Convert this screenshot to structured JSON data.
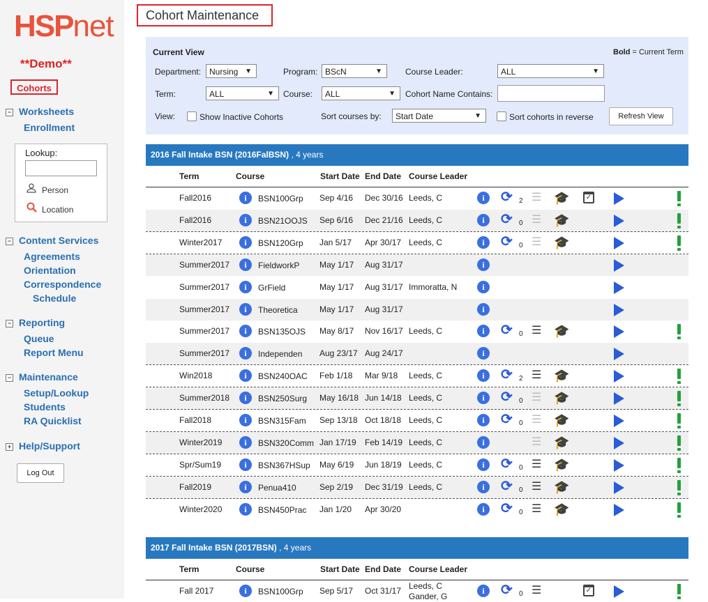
{
  "sidebar": {
    "logo_a": "HSP",
    "logo_b": "net",
    "demo": "**Demo**",
    "cohorts": "Cohorts",
    "worksheets": "Worksheets",
    "enrollment": "Enrollment",
    "lookup_label": "Lookup:",
    "person": "Person",
    "location": "Location",
    "content_services": "Content Services",
    "agreements": "Agreements",
    "orientation": "Orientation",
    "correspondence": "Correspondence",
    "schedule": "Schedule",
    "reporting": "Reporting",
    "queue": "Queue",
    "report_menu": "Report Menu",
    "maintenance": "Maintenance",
    "setup_lookup": "Setup/Lookup",
    "students": "Students",
    "ra_quicklist": "RA Quicklist",
    "help_support": "Help/Support",
    "logout": "Log Out",
    "toggle_minus": "−",
    "toggle_plus": "+"
  },
  "page": {
    "title": "Cohort Maintenance"
  },
  "current_view": {
    "heading": "Current View",
    "bold_note": "Bold = Current Term",
    "department_label": "Department:",
    "department_value": "Nursing",
    "program_label": "Program:",
    "program_value": "BScN",
    "course_leader_label": "Course Leader:",
    "course_leader_value": "ALL",
    "term_label": "Term:",
    "term_value": "ALL",
    "course_label": "Course:",
    "course_value": "ALL",
    "cohort_name_label": "Cohort Name Contains:",
    "view_label": "View:",
    "show_inactive": "Show Inactive Cohorts",
    "sort_label": "Sort courses by:",
    "sort_value": "Start Date",
    "sort_reverse": "Sort cohorts in reverse",
    "refresh": "Refresh View"
  },
  "columns": {
    "term": "Term",
    "course": "Course",
    "start": "Start Date",
    "end": "End Date",
    "leader": "Course Leader"
  },
  "cohort1": {
    "name": "2016 Fall Intake BSN (2016FalBSN)",
    "suffix": ", 4 years",
    "rows": [
      {
        "term": "Fall2016",
        "course": "BSN100Grp",
        "start": "Sep 4/16",
        "end": "Dec 30/16",
        "leader": "Leeds, C",
        "count": "2"
      },
      {
        "term": "Fall2016",
        "course": "BSN21OOJS",
        "start": "Sep 6/16",
        "end": "Dec 21/16",
        "leader": "Leeds, C",
        "count": "0"
      },
      {
        "term": "Winter2017",
        "course": "BSN120Grp",
        "start": "Jan 5/17",
        "end": "Apr 30/17",
        "leader": "Leeds, C",
        "count": "0"
      },
      {
        "term": "Summer2017",
        "course": "FieldworkP",
        "start": "May 1/17",
        "end": "Aug 31/17",
        "leader": "",
        "count": ""
      },
      {
        "term": "Summer2017",
        "course": "GrField",
        "start": "May 1/17",
        "end": "Aug 31/17",
        "leader": "Immoratta, N",
        "count": ""
      },
      {
        "term": "Summer2017",
        "course": "Theoretica",
        "start": "May 1/17",
        "end": "Aug 31/17",
        "leader": "",
        "count": ""
      },
      {
        "term": "Summer2017",
        "course": "BSN135OJS",
        "start": "May 8/17",
        "end": "Nov 16/17",
        "leader": "Leeds, C",
        "count": "0"
      },
      {
        "term": "Summer2017",
        "course": "Independen",
        "start": "Aug 23/17",
        "end": "Aug 24/17",
        "leader": "",
        "count": ""
      },
      {
        "term": "Win2018",
        "course": "BSN240OAC",
        "start": "Feb 1/18",
        "end": "Mar 9/18",
        "leader": "Leeds, C",
        "count": "2"
      },
      {
        "term": "Summer2018",
        "course": "BSN250Surg",
        "start": "May 16/18",
        "end": "Jun 14/18",
        "leader": "Leeds, C",
        "count": "0"
      },
      {
        "term": "Fall2018",
        "course": "BSN315Fam",
        "start": "Sep 13/18",
        "end": "Oct 18/18",
        "leader": "Leeds, C",
        "count": "0"
      },
      {
        "term": "Winter2019",
        "course": "BSN320Comm",
        "start": "Jan 17/19",
        "end": "Feb 14/19",
        "leader": "Leeds, C",
        "count": ""
      },
      {
        "term": "Spr/Sum19",
        "course": "BSN367HSup",
        "start": "May 6/19",
        "end": "Jun 18/19",
        "leader": "Leeds, C",
        "count": "0"
      },
      {
        "term": "Fall2019",
        "course": "Penua410",
        "start": "Sep 2/19",
        "end": "Dec 31/19",
        "leader": "Leeds, C",
        "count": "0"
      },
      {
        "term": "Winter2020",
        "course": "BSN450Prac",
        "start": "Jan 1/20",
        "end": "Apr 30/20",
        "leader": "",
        "count": "0"
      }
    ]
  },
  "cohort2": {
    "name": "2017 Fall Intake BSN (2017BSN)",
    "suffix": ", 4 years",
    "rows": [
      {
        "term": "Fall 2017",
        "course": "BSN100Grp",
        "start": "Sep 5/17",
        "end": "Oct 31/17",
        "leader": "Leeds, C",
        "leader2": "Gander, G",
        "count": "0"
      }
    ]
  },
  "icons": {
    "info": "i",
    "sync": "⟳",
    "list": "☰",
    "cap": "🎓",
    "cal": "✓"
  }
}
